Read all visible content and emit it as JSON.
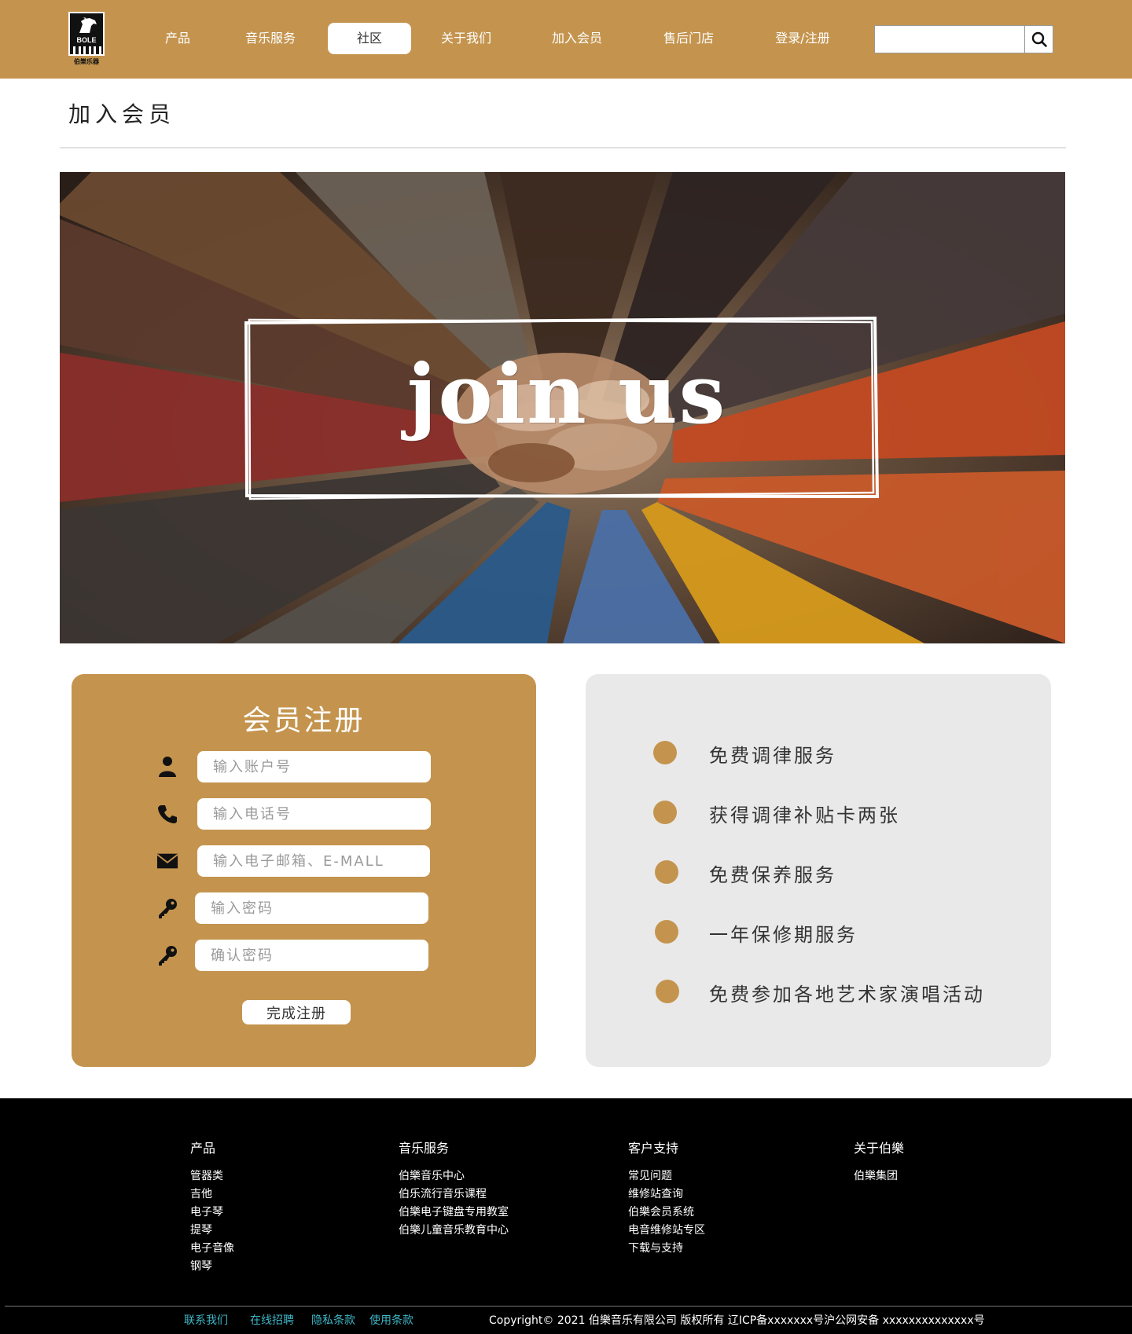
{
  "brand": {
    "logo_text": "BOLE",
    "logo_subtext": "伯樂乐器",
    "colors": {
      "accent": "#c4944e",
      "panel": "#e9e9e9",
      "footer_bg": "#000000",
      "footer_link": "#3fb6c6"
    }
  },
  "nav": {
    "items": [
      "产品",
      "音乐服务",
      "社区",
      "关于我们",
      "加入会员",
      "售后门店",
      "登录/注册"
    ],
    "active": "社区"
  },
  "search": {
    "value": "",
    "placeholder": "",
    "icon": "search-icon"
  },
  "page": {
    "title": "加入会员"
  },
  "banner": {
    "caption": "join us"
  },
  "register": {
    "title": "会员注册",
    "fields": [
      {
        "icon": "user-icon",
        "placeholder": "输入账户号"
      },
      {
        "icon": "phone-icon",
        "placeholder": "输入电话号"
      },
      {
        "icon": "mail-icon",
        "placeholder": "输入电子邮箱、E-MALL"
      },
      {
        "icon": "key-icon",
        "placeholder": "输入密码"
      },
      {
        "icon": "key-icon",
        "placeholder": "确认密码"
      }
    ],
    "submit_label": "完成注册"
  },
  "benefits": [
    "免费调律服务",
    "获得调律补贴卡两张",
    "免费保养服务",
    "一年保修期服务",
    "免费参加各地艺术家演唱活动"
  ],
  "footer": {
    "columns": [
      {
        "title": "产品",
        "items": [
          "管器类",
          "吉他",
          "电子琴",
          "提琴",
          "电子音像",
          "钢琴"
        ]
      },
      {
        "title": "音乐服务",
        "items": [
          "伯樂音乐中心",
          "伯乐流行音乐课程",
          "伯樂电子键盘专用教室",
          "伯樂儿童音乐教育中心"
        ]
      },
      {
        "title": "客户支持",
        "items": [
          "常见问题",
          "维修站查询",
          "伯樂会员系统",
          "电音维修站专区",
          "下载与支持"
        ]
      },
      {
        "title": "关于伯樂",
        "items": [
          "伯樂集团"
        ]
      }
    ],
    "links": [
      "联系我们",
      "在线招聘",
      "隐私条款",
      "使用条款"
    ],
    "copyright": "Copyright© 2021 伯樂音乐有限公司 版权所有 辽ICP备xxxxxxx号沪公网安备 xxxxxxxxxxxxxx号"
  }
}
